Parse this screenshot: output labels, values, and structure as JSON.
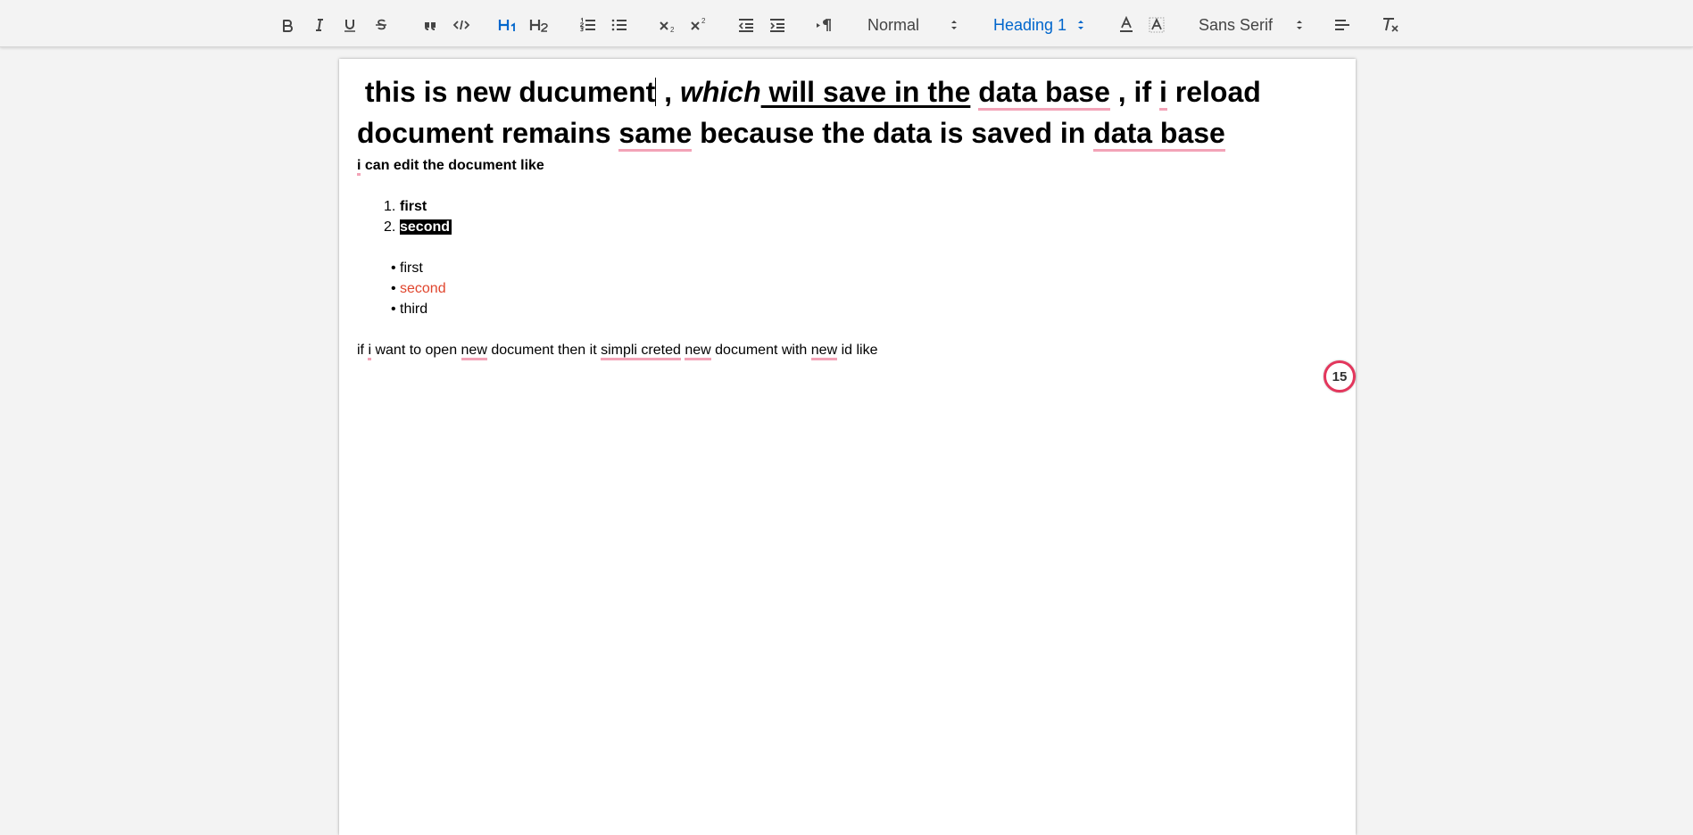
{
  "toolbar": {
    "buttons": [
      {
        "name": "bold-button",
        "icon": "bold-icon"
      },
      {
        "name": "italic-button",
        "icon": "italic-icon"
      },
      {
        "name": "underline-button",
        "icon": "underline-icon"
      },
      {
        "name": "strike-button",
        "icon": "strikethrough-icon"
      },
      {
        "name": "blockquote-button",
        "icon": "quote-icon"
      },
      {
        "name": "code-block-button",
        "icon": "code-icon"
      },
      {
        "name": "header-1-button",
        "icon": "h1-icon",
        "label": "H1",
        "active": true
      },
      {
        "name": "header-2-button",
        "icon": "h2-icon",
        "label": "H2"
      },
      {
        "name": "ordered-list-button",
        "icon": "ordered-list-icon"
      },
      {
        "name": "bullet-list-button",
        "icon": "bullet-list-icon"
      },
      {
        "name": "subscript-button",
        "icon": "subscript-icon"
      },
      {
        "name": "superscript-button",
        "icon": "superscript-icon"
      },
      {
        "name": "outdent-button",
        "icon": "outdent-icon"
      },
      {
        "name": "indent-button",
        "icon": "indent-icon"
      },
      {
        "name": "direction-button",
        "icon": "text-direction-icon"
      },
      {
        "name": "color-button",
        "icon": "text-color-icon"
      },
      {
        "name": "background-button",
        "icon": "background-color-icon"
      },
      {
        "name": "align-button",
        "icon": "align-left-icon"
      },
      {
        "name": "clean-button",
        "icon": "clear-format-icon"
      }
    ],
    "size_picker": "Normal",
    "header_picker": "Heading 1",
    "font_picker": "Sans Serif",
    "active_color": "#0066cc"
  },
  "document": {
    "heading": {
      "p1": "this is new ducument",
      "p2": " , ",
      "p3": "which",
      "p4": " will save in the",
      "p5": " ",
      "p6": "data base",
      "p7": " , ",
      "p8": "if ",
      "p9": "i",
      "p10": " reload document remains ",
      "p11": "same",
      "p12": " because the data is saved in ",
      "p13": "data base"
    },
    "subline": {
      "i": "i",
      "rest": " can edit the document like"
    },
    "ordered_list": [
      {
        "num": "1.",
        "text": "first"
      },
      {
        "num": "2.",
        "text": "second"
      }
    ],
    "bullet_list": [
      {
        "bullet": "•",
        "text": "first"
      },
      {
        "bullet": "•",
        "text": "second",
        "color": "#e0452d"
      },
      {
        "bullet": "•",
        "text": "third"
      }
    ],
    "paragraph": {
      "a": "if ",
      "b": "i",
      "c": " want to open ",
      "d": "new",
      "e": " document then it ",
      "f": "simpli creted",
      "g": " ",
      "h": "new",
      "i": " document with ",
      "j": "new",
      "k": " id like"
    }
  },
  "badge": {
    "count": "15",
    "color": "#e3365c"
  }
}
